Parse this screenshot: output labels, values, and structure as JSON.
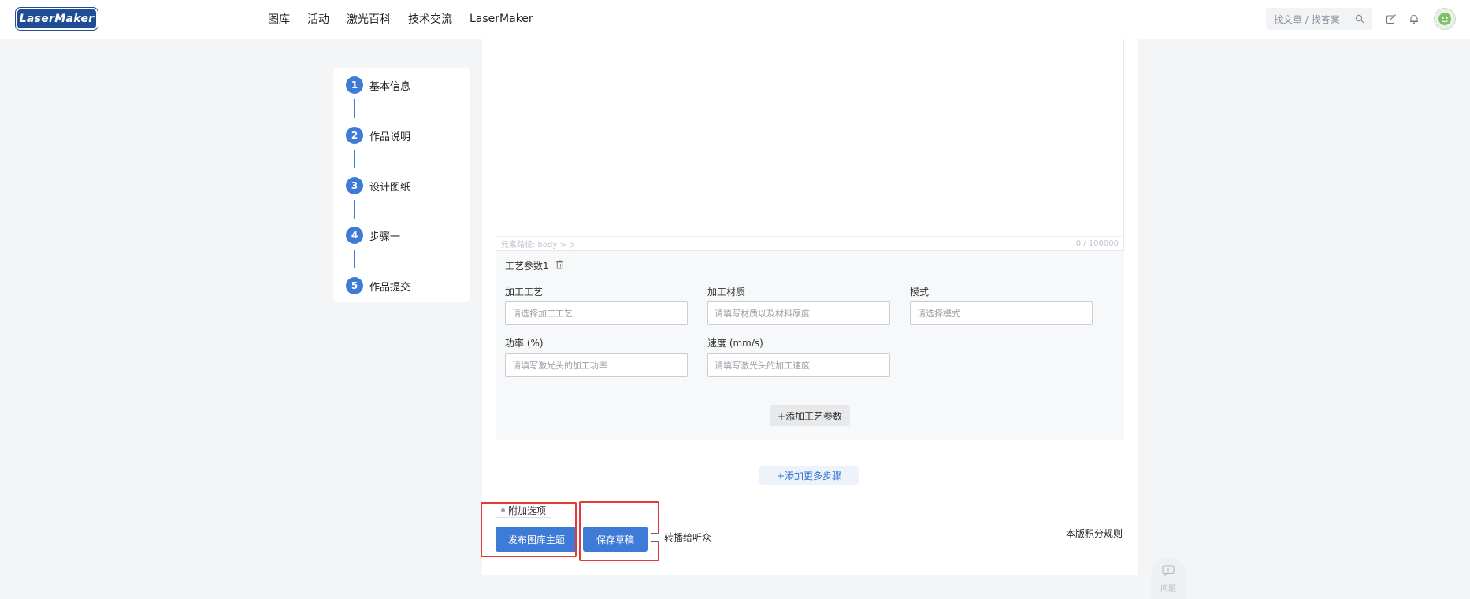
{
  "brand": {
    "logo_text": "LaserMaker"
  },
  "nav": {
    "items": [
      {
        "label": "图库"
      },
      {
        "label": "活动"
      },
      {
        "label": "激光百科"
      },
      {
        "label": "技术交流"
      },
      {
        "label": "LaserMaker"
      }
    ]
  },
  "search": {
    "placeholder": "找文章 / 找答案",
    "icon": "search-icon"
  },
  "header_icons": [
    "edit-icon",
    "bell-icon",
    "avatar"
  ],
  "steps": [
    {
      "num": "1",
      "label": "基本信息"
    },
    {
      "num": "2",
      "label": "作品说明"
    },
    {
      "num": "3",
      "label": "设计图纸"
    },
    {
      "num": "4",
      "label": "步骤一"
    },
    {
      "num": "5",
      "label": "作品提交"
    }
  ],
  "editor": {
    "path_label": "元素路径: body > p",
    "char_count": "0 / 100000"
  },
  "process": {
    "title": "工艺参数1",
    "fields": {
      "craft": {
        "label": "加工工艺",
        "placeholder": "请选择加工工艺"
      },
      "material": {
        "label": "加工材质",
        "placeholder": "请填写材质以及材料厚度"
      },
      "mode": {
        "label": "模式",
        "placeholder": "请选择模式"
      },
      "power": {
        "label": "功率 (%)",
        "placeholder": "请填写激光头的加工功率"
      },
      "speed": {
        "label": "速度 (mm/s)",
        "placeholder": "请填写激光头的加工速度"
      }
    },
    "add_param_label": "+添加工艺参数"
  },
  "add_step_label": "+添加更多步骤",
  "extra_options_label": "附加选项",
  "actions": {
    "publish_label": "发布图库主题",
    "save_draft_label": "保存草稿",
    "repost_label": "转播给听众",
    "rules_label": "本版积分规则"
  },
  "feedback": {
    "label": "问题"
  },
  "colors": {
    "primary": "#3e7bd6",
    "highlight": "#e53935",
    "page_bg": "#f4f5f7"
  }
}
